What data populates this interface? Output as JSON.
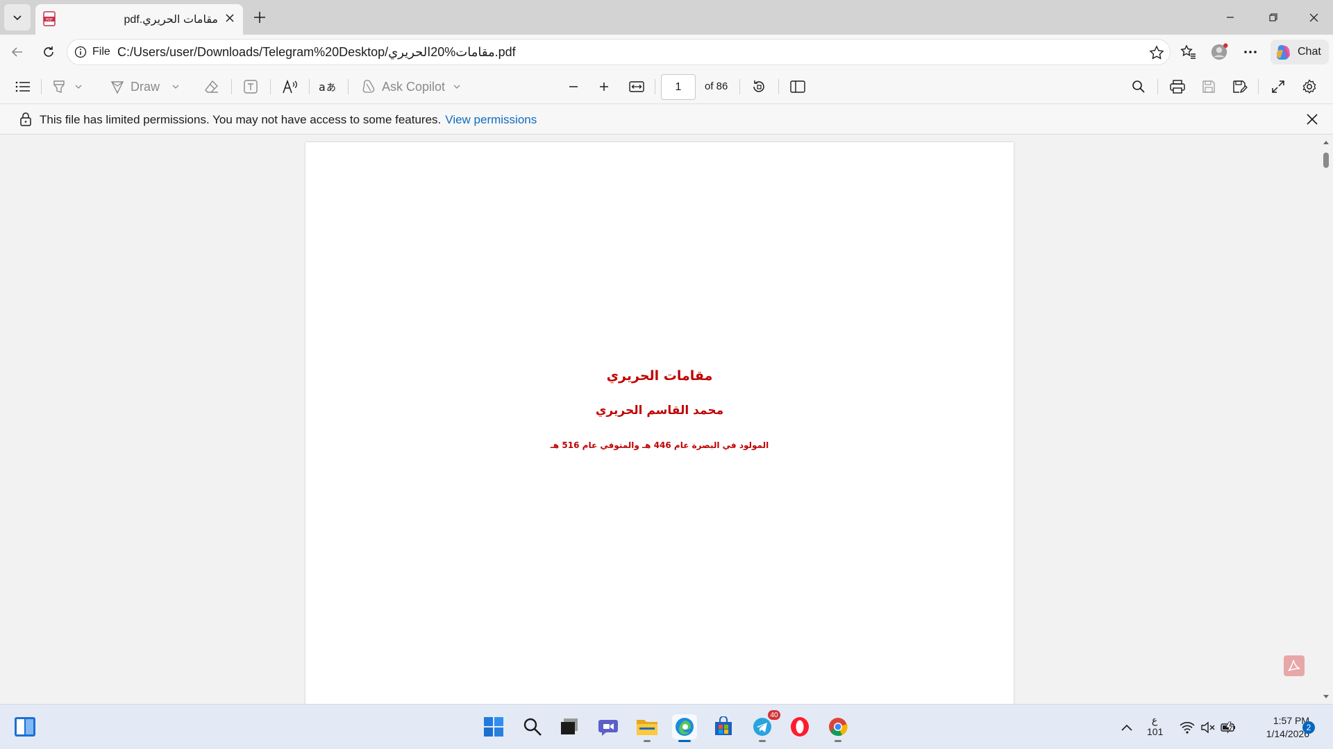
{
  "browser": {
    "tab": {
      "title": "pdf.مقامات الحريري"
    },
    "address": {
      "scheme_label": "File",
      "url": "C:/Users/user/Downloads/Telegram%20Desktop/مقامات%20الحريري.pdf"
    },
    "chat_label": "Chat"
  },
  "pdf_toolbar": {
    "draw_label": "Draw",
    "copilot_label": "Ask Copilot",
    "page_current": "1",
    "page_total_label": "of 86"
  },
  "infobar": {
    "message": "This file has limited permissions. You may not have access to some features.",
    "link": "View permissions"
  },
  "document": {
    "title": "مقامات الحريري",
    "author": "محمد القاسم الحريري",
    "subtitle": "المولود في البصرة عام 446 هـ والمتوفي عام 516 هـ"
  },
  "taskbar": {
    "telegram_badge": "40",
    "ime_lines": [
      "ع",
      "101"
    ],
    "time": "1:57 PM",
    "date": "1/14/2026",
    "notification_count": "2"
  },
  "colors": {
    "accent": "#0f6cbd",
    "doc_text": "#c00000",
    "taskbar": "#e3eaf5"
  }
}
